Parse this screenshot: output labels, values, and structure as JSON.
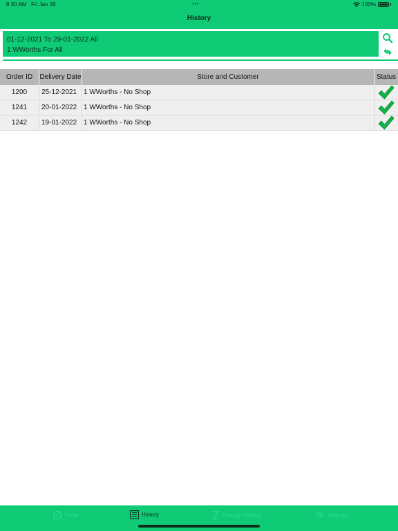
{
  "status_bar": {
    "time": "8:30 AM",
    "date": "Fri Jan 28",
    "dots": "•••",
    "battery": "100%"
  },
  "nav": {
    "title": "History"
  },
  "filter": {
    "line1": "01-12-2021 To 29-01-2022   All",
    "line2": "1 WWorths For All"
  },
  "table": {
    "headers": [
      "Order ID",
      "Delivery Date",
      "Store and Customer",
      "Status"
    ],
    "rows": [
      {
        "order_id": "1200",
        "delivery_date": "25-12-2021",
        "store_customer": "1 WWorths  -  No Shop",
        "status": "complete"
      },
      {
        "order_id": "1241",
        "delivery_date": "20-01-2022",
        "store_customer": "1 WWorths  -  No Shop",
        "status": "complete"
      },
      {
        "order_id": "1242",
        "delivery_date": "19-01-2022",
        "store_customer": "1 WWorths  -  No Shop",
        "status": "complete"
      }
    ]
  },
  "tabs": [
    {
      "label": "Order",
      "icon": "order-icon",
      "active": false
    },
    {
      "label": "History",
      "icon": "list-icon",
      "active": true
    },
    {
      "label": "Change Display",
      "icon": "display-icon",
      "active": false
    },
    {
      "label": "Settings",
      "icon": "settings-icon",
      "active": false
    }
  ],
  "colors": {
    "accent": "#0fcb76",
    "header_bg": "#b6b6b6",
    "check": "#11b34a"
  }
}
